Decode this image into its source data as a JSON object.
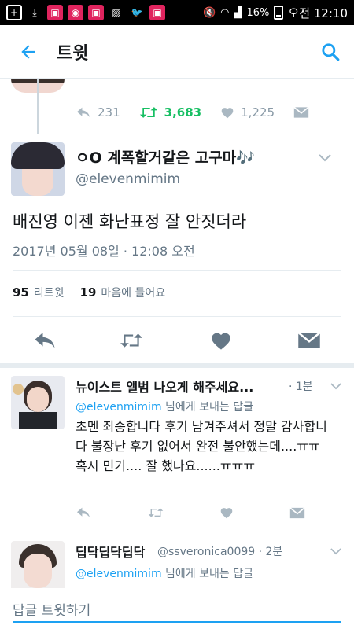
{
  "status_bar": {
    "battery": "16%",
    "time": "오전 12:10",
    "icons": [
      "add-icon",
      "download-icon",
      "app-icon",
      "app-icon",
      "app-icon",
      "image-icon",
      "twitter-icon",
      "app-icon",
      "mute-icon",
      "wifi-icon",
      "signal-icon",
      "battery-icon"
    ]
  },
  "header": {
    "title": "트윗",
    "back_icon": "arrow-left-icon",
    "search_icon": "search-icon"
  },
  "prev_tweet": {
    "replies": "231",
    "retweets": "3,683",
    "likes": "1,225"
  },
  "tweet": {
    "display_name": "ㅇO 계폭할거같은 고구마🎶",
    "handle": "@elevenmimim",
    "text": "배진영 이젠 화난표정 잘 안짓더라",
    "timestamp": "2017년 05월 08일 · 12:08 오전",
    "retweet_count": "95",
    "retweet_label": "리트윗",
    "like_count": "19",
    "like_label": "마음에 들어요"
  },
  "replies": [
    {
      "display_name": "뉴이스트 앨범 나오게 해주세요...",
      "time": "· 1분",
      "reply_to_handle": "@elevenmimim",
      "reply_to_suffix": "님에게 보내는 답글",
      "text": "초멘 죄송합니다 후기 남겨주셔서 정말 감사합니다 불장난 후기 없어서 완전 불안했는데....ㅠㅠ 혹시 민기.... 잘 했나요......ㅠㅠㅠ"
    },
    {
      "display_name": "딥닥딥닥딥닥",
      "handle_time": "@ssveronica0099 · 2분",
      "reply_to_handle": "@elevenmimim",
      "reply_to_suffix": "님에게 보내는 답글"
    }
  ],
  "compose": {
    "placeholder": "답글 트윗하기"
  },
  "colors": {
    "accent": "#1da1f2",
    "retweet_green": "#17bf63",
    "secondary_text": "#657786",
    "icon_gray": "#8899a6"
  }
}
